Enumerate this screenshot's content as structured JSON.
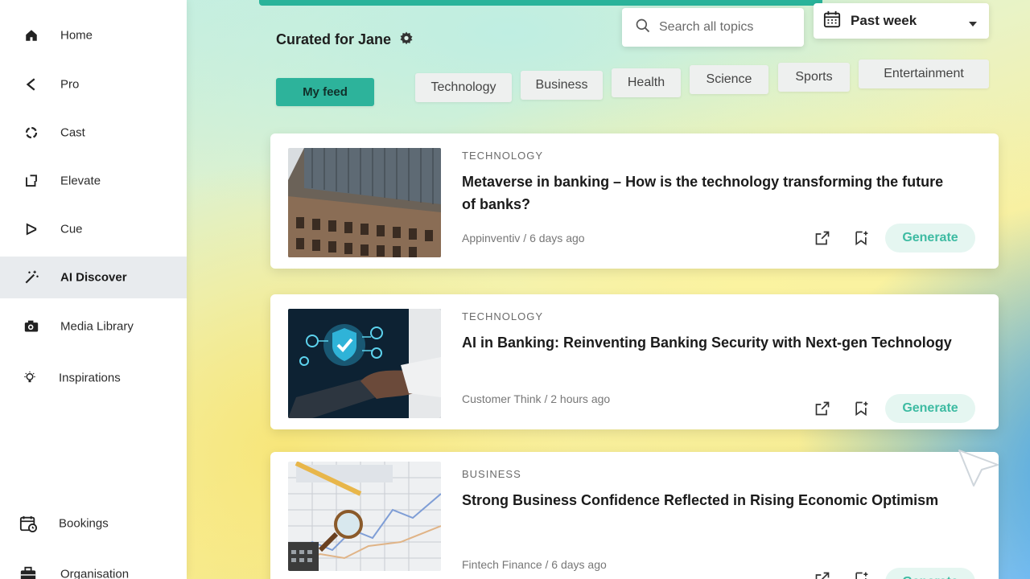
{
  "sidebar": {
    "items": [
      {
        "label": "Home",
        "icon": "home-icon"
      },
      {
        "label": "Pro",
        "icon": "chevron-left-icon"
      },
      {
        "label": "Cast",
        "icon": "circle-dots-icon"
      },
      {
        "label": "Elevate",
        "icon": "elevate-icon"
      },
      {
        "label": "Cue",
        "icon": "cue-icon"
      },
      {
        "label": "AI Discover",
        "icon": "magic-wand-icon",
        "active": true
      },
      {
        "label": "Media Library",
        "icon": "camera-icon"
      },
      {
        "label": "Inspirations",
        "icon": "lightbulb-icon"
      }
    ],
    "bottom_items": [
      {
        "label": "Bookings",
        "icon": "calendar-clock-icon"
      },
      {
        "label": "Organisation",
        "icon": "briefcase-icon"
      }
    ]
  },
  "header": {
    "curated_title": "Curated for Jane",
    "search_placeholder": "Search all topics",
    "date_range": "Past week"
  },
  "filters": {
    "my_feed": "My feed",
    "topics": [
      "Technology",
      "Business",
      "Health",
      "Science",
      "Sports",
      "Entertainment"
    ]
  },
  "articles": [
    {
      "category": "TECHNOLOGY",
      "title": "Metaverse in banking – How is the technology transforming the future of banks?",
      "source": "Appinventiv",
      "time": "6 days ago",
      "action": "Generate"
    },
    {
      "category": "TECHNOLOGY",
      "title": "AI in Banking: Reinventing Banking Security with Next-gen Technology",
      "source": "Customer Think",
      "time": "2 hours ago",
      "action": "Generate"
    },
    {
      "category": "BUSINESS",
      "title": "Strong Business Confidence Reflected in Rising Economic Optimism",
      "source": "Fintech Finance",
      "time": "6 days ago",
      "action": "Generate"
    }
  ],
  "colors": {
    "accent": "#2db39b",
    "generate_text": "#3dbba2",
    "generate_bg": "#e5f6f1",
    "active_nav_bg": "#e8ebee"
  }
}
